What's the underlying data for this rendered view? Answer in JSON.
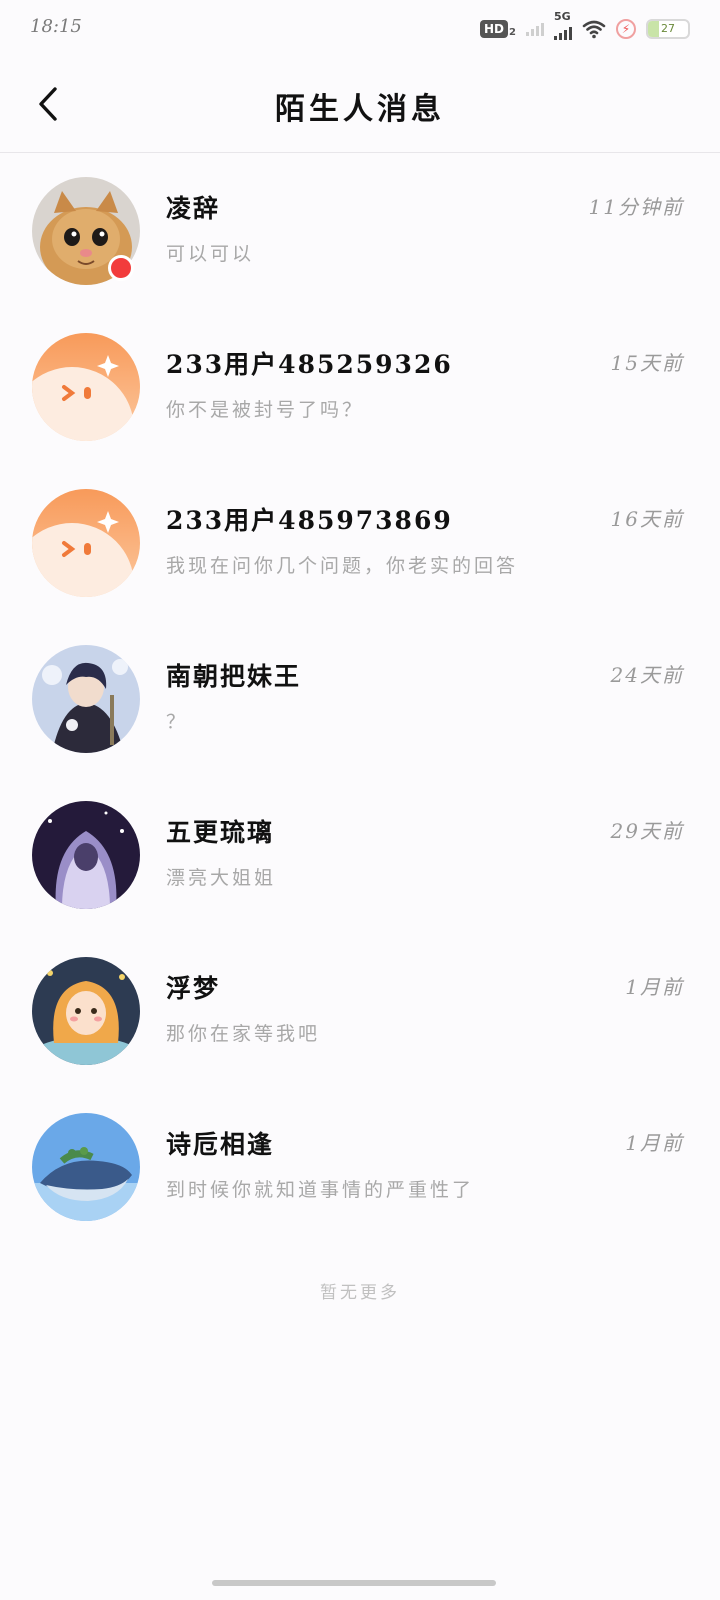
{
  "status_bar": {
    "time": "18:15",
    "hd_label": "HD",
    "hd_sub": "2",
    "network_label": "5G",
    "battery_level": "27"
  },
  "header": {
    "title": "陌生人消息"
  },
  "messages": [
    {
      "name": "凌辞",
      "time": "11分钟前",
      "preview": "可以可以",
      "avatar": "kitten-photo"
    },
    {
      "name": "233用户485259326",
      "time": "15天前",
      "preview": "你不是被封号了吗？",
      "avatar": "default-orange"
    },
    {
      "name": "233用户485973869",
      "time": "16天前",
      "preview": "我现在问你几个问题，你老实的回答",
      "avatar": "default-orange"
    },
    {
      "name": "南朝把妹王",
      "time": "24天前",
      "preview": "？",
      "avatar": "anime-boy"
    },
    {
      "name": "五更琉璃",
      "time": "29天前",
      "preview": "漂亮大姐姐",
      "avatar": "anime-girl-night"
    },
    {
      "name": "浮梦",
      "time": "1月前",
      "preview": "那你在家等我吧",
      "avatar": "cartoon-girl"
    },
    {
      "name": "诗卮相逢",
      "time": "1月前",
      "preview": "到时候你就知道事情的严重性了",
      "avatar": "whale-island"
    }
  ],
  "footer": {
    "no_more": "暂无更多"
  },
  "colors": {
    "background": "#fcfbfd",
    "name_text": "#111111",
    "secondary_text": "#a8a8a8",
    "default_avatar": "#f89a5a"
  }
}
